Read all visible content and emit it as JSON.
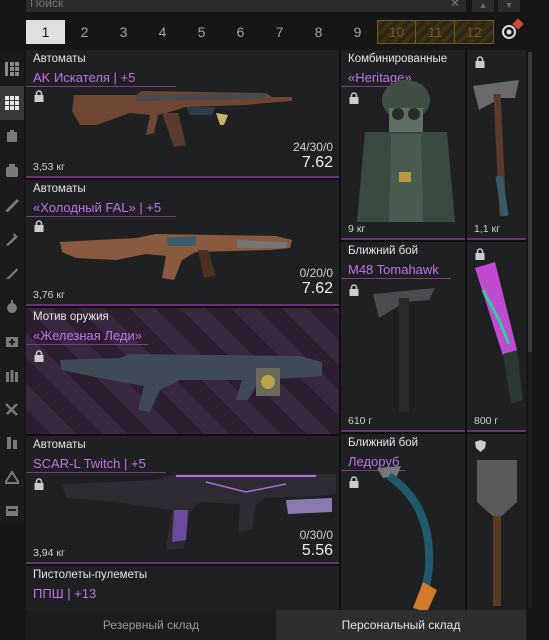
{
  "search": {
    "placeholder": "Поиск",
    "clear_icon": "close-icon"
  },
  "page_tabs": [
    {
      "label": "1",
      "active": true
    },
    {
      "label": "2"
    },
    {
      "label": "3"
    },
    {
      "label": "4"
    },
    {
      "label": "5"
    },
    {
      "label": "6"
    },
    {
      "label": "7"
    },
    {
      "label": "8"
    },
    {
      "label": "9"
    },
    {
      "label": "10",
      "locked": true
    },
    {
      "label": "11",
      "locked": true
    },
    {
      "label": "12",
      "locked": true
    }
  ],
  "rail_icons": [
    "grid-view-icon",
    "all-items-icon",
    "armor-icon",
    "backpack-icon",
    "rifle-icon",
    "melee-icon",
    "knife-icon",
    "grenade-icon",
    "medkit-icon",
    "ammo-icon",
    "tools-icon",
    "attachments-icon",
    "misc-icon",
    "storage-icon"
  ],
  "items": {
    "ak": {
      "category": "Автоматы",
      "name": "AK Искателя | +5",
      "weight": "3,53 кг",
      "ammo": "24/30/0",
      "caliber": "7.62"
    },
    "fal": {
      "category": "Автоматы",
      "name": "«Холодный FAL» | +5",
      "weight": "3,76 кг",
      "ammo": "0/20/0",
      "caliber": "7.62"
    },
    "motif": {
      "category": "Мотив оружия",
      "name": "«Железная Леди»"
    },
    "scar": {
      "category": "Автоматы",
      "name": "SCAR-L Twitch | +5",
      "weight": "3,94 кг",
      "ammo": "0/30/0",
      "caliber": "5.56"
    },
    "pp": {
      "category": "Пистолеты-пулеметы",
      "name": "ППШ | +13"
    },
    "heritage": {
      "category": "Комбинированные",
      "name": "«Heritage»",
      "weight": "9 кг"
    },
    "tomahawk": {
      "category": "Ближний бой",
      "name": "M48 Tomahawk",
      "weight": "610 г"
    },
    "ledorub": {
      "category": "Ближний бой",
      "name": "Ледоруб"
    },
    "axe": {
      "weight": "1,1 кг"
    },
    "machete": {
      "weight": "800 г"
    }
  },
  "bottom_tabs": [
    {
      "label": "Резервный склад"
    },
    {
      "label": "Персональный склад",
      "active": true
    }
  ],
  "colors": {
    "accent": "#c471ed",
    "locked_tab": "#6e5a22",
    "active_tab": "#e0e0e0"
  }
}
